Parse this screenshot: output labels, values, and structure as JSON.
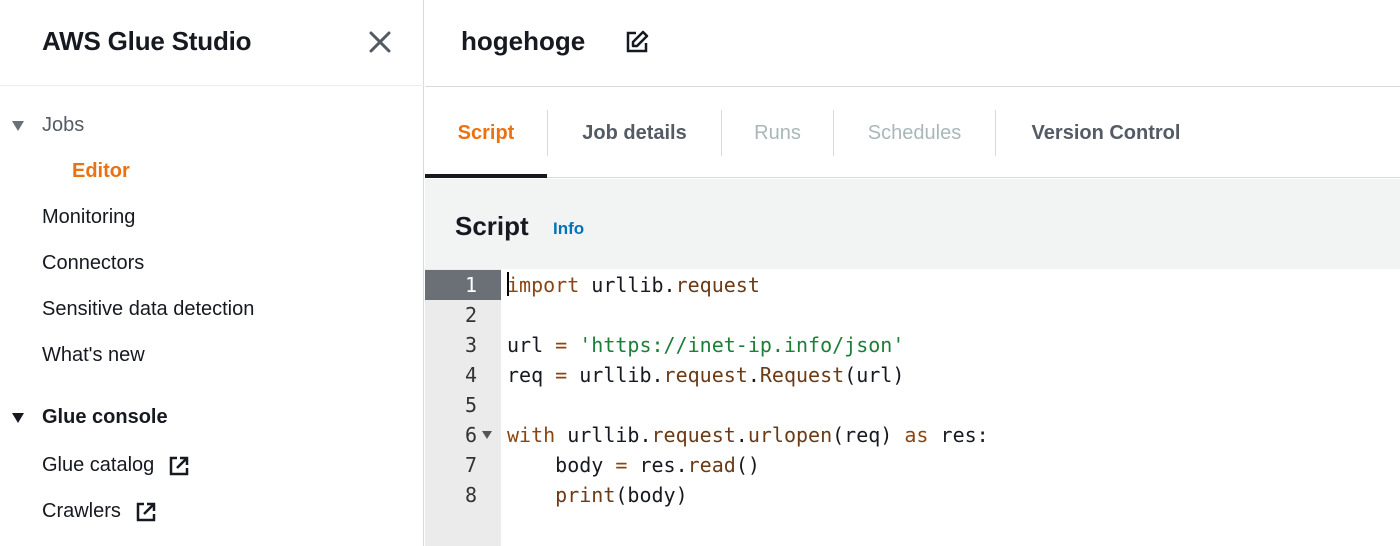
{
  "sidebar": {
    "title": "AWS Glue Studio",
    "close_icon": "close-icon",
    "jobs_section": "Jobs",
    "jobs_items": [
      {
        "label": "Editor",
        "active": true
      }
    ],
    "items": [
      {
        "label": "Monitoring"
      },
      {
        "label": "Connectors"
      },
      {
        "label": "Sensitive data detection"
      },
      {
        "label": "What's new"
      }
    ],
    "glue_console_section": "Glue console",
    "console_items": [
      {
        "label": "Glue catalog",
        "icon": "external-link-icon"
      },
      {
        "label": "Crawlers",
        "icon": "external-link-icon"
      }
    ]
  },
  "header": {
    "job_name": "hogehoge",
    "edit_icon": "edit-icon"
  },
  "tabs": [
    {
      "label": "Script",
      "state": "active"
    },
    {
      "label": "Job details",
      "state": "normal"
    },
    {
      "label": "Runs",
      "state": "disabled"
    },
    {
      "label": "Schedules",
      "state": "disabled"
    },
    {
      "label": "Version Control",
      "state": "normal"
    }
  ],
  "script": {
    "title": "Script",
    "info_label": "Info",
    "line_numbers": [
      "1",
      "2",
      "3",
      "4",
      "5",
      "6",
      "7",
      "8"
    ],
    "active_line": 1,
    "lines": [
      [
        {
          "t": "import",
          "c": "kw2"
        },
        {
          "t": " urllib.",
          "c": ""
        },
        {
          "t": "request",
          "c": "fn"
        }
      ],
      [],
      [
        {
          "t": "url ",
          "c": ""
        },
        {
          "t": "=",
          "c": "kw2"
        },
        {
          "t": " ",
          "c": ""
        },
        {
          "t": "'https://inet-ip.info/json'",
          "c": "str"
        }
      ],
      [
        {
          "t": "req ",
          "c": ""
        },
        {
          "t": "=",
          "c": "kw2"
        },
        {
          "t": " urllib.",
          "c": ""
        },
        {
          "t": "request",
          "c": "fn"
        },
        {
          "t": ".",
          "c": ""
        },
        {
          "t": "Request",
          "c": "fn"
        },
        {
          "t": "(url)",
          "c": ""
        }
      ],
      [],
      [
        {
          "t": "with",
          "c": "kw2"
        },
        {
          "t": " urllib.",
          "c": ""
        },
        {
          "t": "request",
          "c": "fn"
        },
        {
          "t": ".",
          "c": ""
        },
        {
          "t": "urlopen",
          "c": "fn"
        },
        {
          "t": "(req) ",
          "c": ""
        },
        {
          "t": "as",
          "c": "kw2"
        },
        {
          "t": " res:",
          "c": ""
        }
      ],
      [
        {
          "t": "    body ",
          "c": ""
        },
        {
          "t": "=",
          "c": "kw2"
        },
        {
          "t": " res.",
          "c": ""
        },
        {
          "t": "read",
          "c": "fn"
        },
        {
          "t": "()",
          "c": ""
        }
      ],
      [
        {
          "t": "    ",
          "c": ""
        },
        {
          "t": "print",
          "c": "fn"
        },
        {
          "t": "(body)",
          "c": ""
        }
      ]
    ]
  },
  "colors": {
    "accent": "#ec7211",
    "link": "#0073bb",
    "text": "#16191f"
  }
}
